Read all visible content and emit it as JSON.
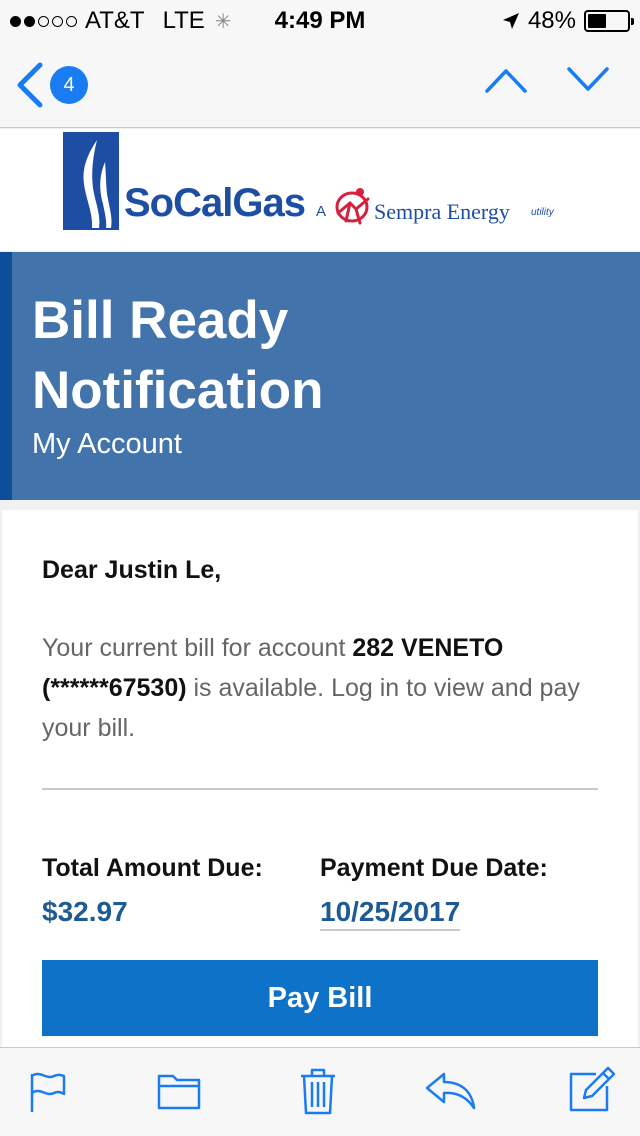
{
  "status_bar": {
    "carrier": "AT&T",
    "network": "LTE",
    "time": "4:49 PM",
    "battery": "48%",
    "battery_level": 0.48,
    "signal_bars_filled": 2,
    "signal_bars_total": 5
  },
  "nav": {
    "unread_count": "4"
  },
  "logo": {
    "brand": "SoCalGas",
    "connector": "A",
    "partner": "Sempra Energy",
    "partner_suffix": "utility"
  },
  "banner": {
    "title": "Bill Ready Notification",
    "subtitle": "My Account"
  },
  "email": {
    "greeting": "Dear Justin Le,",
    "message_prefix": "Your current bill for account ",
    "account_name": "282 VENETO",
    "account_number": "(******67530)",
    "message_suffix": " is available. Log in to view and pay your bill.",
    "total_label": "Total Amount Due:",
    "total_value": "$32.97",
    "due_label": "Payment Due Date:",
    "due_value": "10/25/2017",
    "pay_button": "Pay Bill"
  },
  "colors": {
    "accent": "#1a7cf2",
    "banner": "#4273ab",
    "banner_edge": "#0e4d99",
    "pay_button": "#0d72c8",
    "amount": "#1e5a93"
  },
  "toolbar": {
    "icons": [
      "flag-icon",
      "folder-icon",
      "trash-icon",
      "reply-icon",
      "compose-icon"
    ]
  }
}
